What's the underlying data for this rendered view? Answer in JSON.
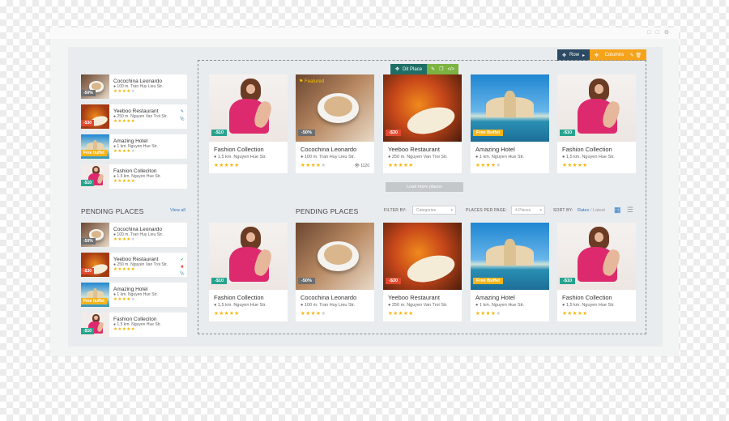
{
  "toolbar": {
    "row_label": "Row",
    "columns_label": "Columns",
    "edit_place_label": "Dit Place"
  },
  "colors": {
    "accent_blue": "#2b78c5",
    "toolbar_navy": "#2c4a63",
    "toolbar_orange": "#f6a31c",
    "star": "#f5b400"
  },
  "sidebar_top": [
    {
      "name": "Cocochina Leonardo",
      "addr": "100 m. Tran Huy Lieu Str.",
      "badge": "-50%",
      "badge_color": "gray",
      "img": "coffee",
      "stars": 4
    },
    {
      "name": "Yeeboo Restaurant",
      "addr": "250 m. Nguyen Van Troi Str.",
      "badge": "-$30",
      "badge_color": "red",
      "img": "food",
      "stars": 5
    },
    {
      "name": "Amazing Hotel",
      "addr": "1 km. Nguyen Hue Str.",
      "badge": "Free buffet",
      "badge_color": "yellow",
      "img": "hotel",
      "stars": 4
    },
    {
      "name": "Fashion Colleciton",
      "addr": "1,5 km. Nguyen Hue Str.",
      "badge": "-$10",
      "badge_color": "green",
      "img": "fashion",
      "stars": 5
    }
  ],
  "pending": {
    "title": "PENDING PLACES",
    "view_all": "View all",
    "items": [
      {
        "name": "Cocochina Leonardo",
        "addr": "100 m. Tran Huy Lieu Str.",
        "badge": "-50%",
        "badge_color": "gray",
        "img": "coffee",
        "stars": 4
      },
      {
        "name": "Yeeboo Restaurant",
        "addr": "250 m. Nguyen Van Troi Str.",
        "badge": "-$30",
        "badge_color": "red",
        "img": "food",
        "stars": 5
      },
      {
        "name": "Amazing Hotel",
        "addr": "1 km. Nguyen Hue Str.",
        "badge": "Free buffet",
        "badge_color": "yellow",
        "img": "hotel",
        "stars": 4
      },
      {
        "name": "Fashion Colleciton",
        "addr": "1,5 km. Nguyen Hue Str.",
        "badge": "-$10",
        "badge_color": "green",
        "img": "fashion",
        "stars": 5
      }
    ]
  },
  "cards_row1": [
    {
      "title": "Fashion Collection",
      "addr": "1,5 km. Nguyen Hue Str.",
      "badge": "-$10",
      "badge_color": "green",
      "img": "fashion",
      "stars": 5
    },
    {
      "title": "Cocochina Leonardo",
      "addr": "100 m. Tran Huy Lieu Str.",
      "badge": "-50%",
      "badge_color": "gray",
      "img": "coffee",
      "stars": 4,
      "featured": "Featured",
      "views": "1120"
    },
    {
      "title": "Yeeboo Restaurant",
      "addr": "250 m. Nguyen Van Troi Str.",
      "badge": "-$30",
      "badge_color": "red",
      "img": "food",
      "stars": 5
    },
    {
      "title": "Amazing Hotel",
      "addr": "1 km. Nguyen Hue Str.",
      "badge": "Free Buffet",
      "badge_color": "yellow",
      "img": "hotel",
      "stars": 4
    },
    {
      "title": "Fashion Collection",
      "addr": "1,5 km. Nguyen Hue Str.",
      "badge": "-$10",
      "badge_color": "green",
      "img": "fashion",
      "stars": 5
    }
  ],
  "load_more": "Load more places",
  "main_pending_title": "PENDING PLACES",
  "filters": {
    "filter_by_label": "FILTER BY:",
    "category_placeholder": "Categories",
    "per_page_label": "PLACES PER PAGE:",
    "per_page_value": "4 Places",
    "sort_by_label": "SORT BY:",
    "sort_active": "Rates",
    "sort_sep": " / ",
    "sort_other": "Latest"
  },
  "cards_row2": [
    {
      "title": "Fashion Collection",
      "addr": "1,5 km. Nguyen Hue Str.",
      "badge": "-$10",
      "badge_color": "green",
      "img": "fashion",
      "stars": 5
    },
    {
      "title": "Cocochina Leonardo",
      "addr": "100 m. Tran Huy Lieu Str.",
      "badge": "-50%",
      "badge_color": "gray",
      "img": "coffee",
      "stars": 4
    },
    {
      "title": "Yeeboo Restaurant",
      "addr": "250 m. Nguyen Van Troi Str.",
      "badge": "-$30",
      "badge_color": "red",
      "img": "food",
      "stars": 5
    },
    {
      "title": "Amazing Hotel",
      "addr": "1 km. Nguyen Hue Str.",
      "badge": "Free Buffet",
      "badge_color": "yellow",
      "img": "hotel",
      "stars": 4
    },
    {
      "title": "Fashion Collection",
      "addr": "1,5 km. Nguyen Hue Str.",
      "badge": "-$10",
      "badge_color": "green",
      "img": "fashion",
      "stars": 5
    }
  ]
}
